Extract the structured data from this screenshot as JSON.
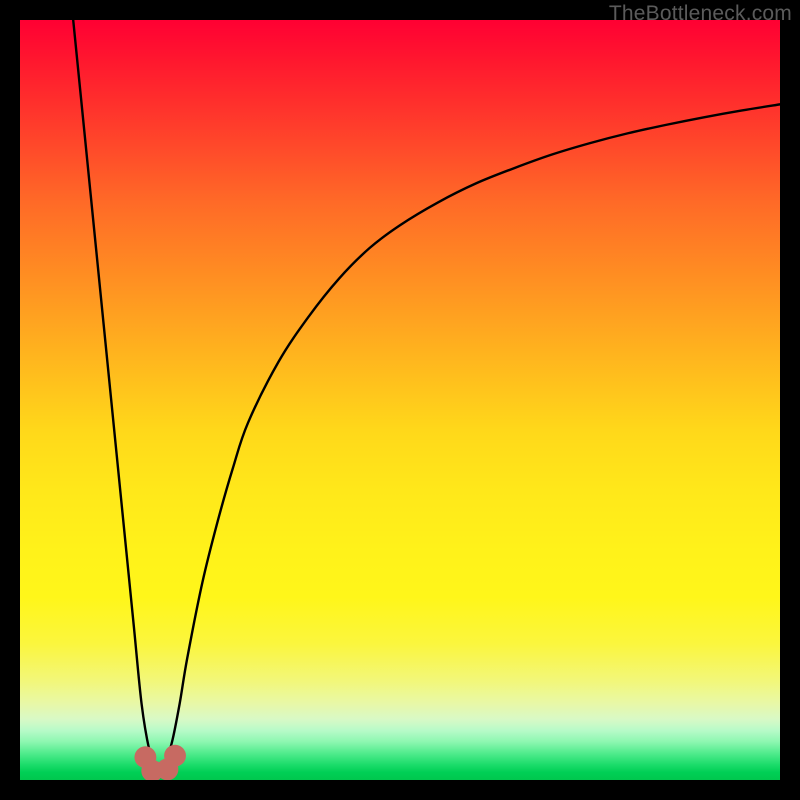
{
  "watermark": {
    "text": "TheBottleneck.com"
  },
  "colors": {
    "curve": "#000000",
    "marker": "#c76a62",
    "frame": "#000000"
  },
  "chart_data": {
    "type": "line",
    "title": "",
    "xlabel": "",
    "ylabel": "",
    "xlim": [
      0,
      100
    ],
    "ylim": [
      0,
      100
    ],
    "grid": false,
    "legend": false,
    "series": [
      {
        "name": "bottleneck-curve",
        "note": "V-shaped curve; estimated percentage of maximum (y) vs position (x). Minimum ~0 near x≈18; rises steeply both sides; right arm approaches ~89 at x=100; left arm exits top (y=100) near x≈7.",
        "x": [
          7,
          8,
          10,
          12,
          14,
          15,
          16,
          17,
          18,
          19,
          20,
          21,
          22,
          24,
          26,
          28,
          30,
          34,
          38,
          42,
          46,
          50,
          55,
          60,
          65,
          70,
          75,
          80,
          85,
          90,
          95,
          100
        ],
        "y": [
          100,
          90,
          70,
          50,
          30,
          20,
          10,
          4,
          1,
          2,
          5,
          10,
          16,
          26,
          34,
          41,
          47,
          55,
          61,
          66,
          70,
          73,
          76,
          78.5,
          80.5,
          82.3,
          83.8,
          85.1,
          86.2,
          87.2,
          88.1,
          88.9
        ]
      }
    ],
    "markers": [
      {
        "name": "notch-left",
        "x": 16.5,
        "y": 3,
        "r": 1.6
      },
      {
        "name": "notch-mid-l",
        "x": 17.4,
        "y": 1.2,
        "r": 1.6
      },
      {
        "name": "notch-mid-r",
        "x": 19.4,
        "y": 1.4,
        "r": 1.6
      },
      {
        "name": "notch-right",
        "x": 20.4,
        "y": 3.2,
        "r": 1.6
      }
    ]
  }
}
